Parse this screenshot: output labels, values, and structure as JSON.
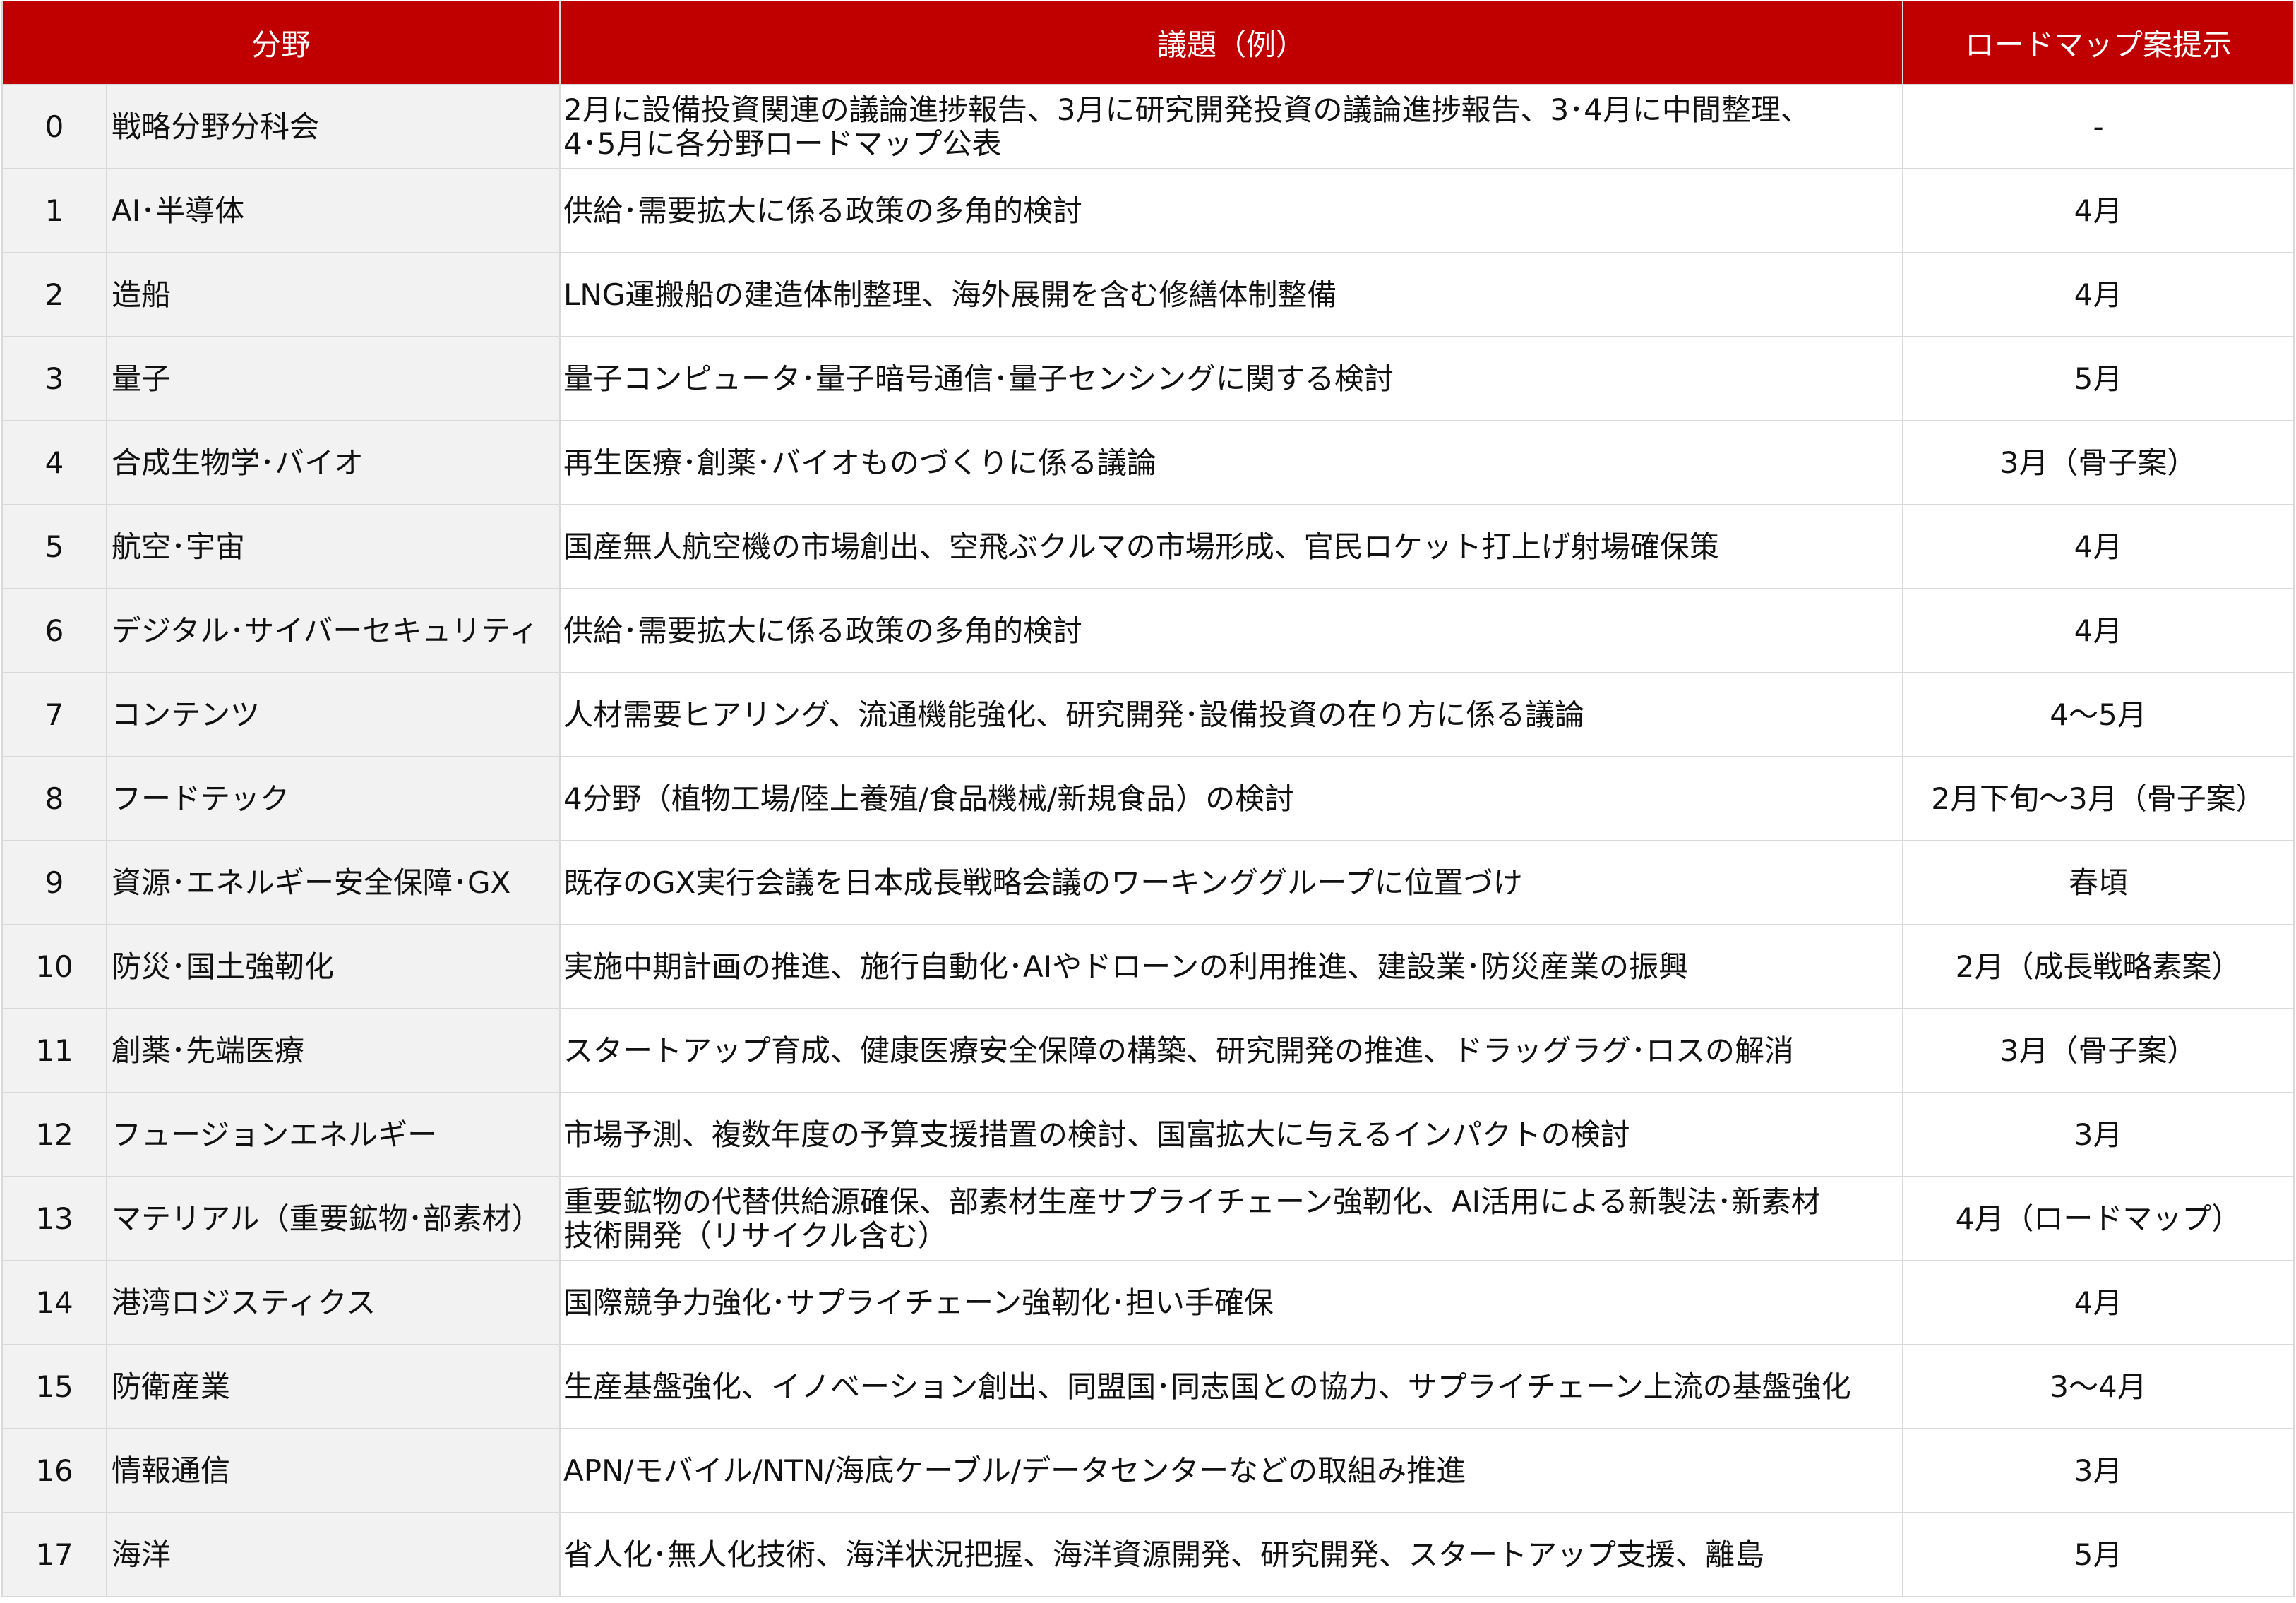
{
  "colors": {
    "header_bg": "#c00000",
    "header_text": "#ffffff",
    "label_col_bg": "#f2f2f2",
    "grid_line": "#d9d9d9"
  },
  "header": {
    "field": "分野",
    "topic": "議題（例）",
    "roadmap": "ロードマップ案提示"
  },
  "rows": [
    {
      "num": "0",
      "field": "戦略分野分科会",
      "topic_lines": [
        "2月に設備投資関連の議論進捗報告、3月に研究開発投資の議論進捗報告、3･4月に中間整理、",
        "4･5月に各分野ロードマップ公表"
      ],
      "roadmap": "-"
    },
    {
      "num": "1",
      "field": "AI･半導体",
      "topic_lines": [
        "供給･需要拡大に係る政策の多角的検討"
      ],
      "roadmap": "4月"
    },
    {
      "num": "2",
      "field": "造船",
      "topic_lines": [
        "LNG運搬船の建造体制整理、海外展開を含む修繕体制整備"
      ],
      "roadmap": "4月"
    },
    {
      "num": "3",
      "field": "量子",
      "topic_lines": [
        "量子コンピュータ･量子暗号通信･量子センシングに関する検討"
      ],
      "roadmap": "5月"
    },
    {
      "num": "4",
      "field": "合成生物学･バイオ",
      "topic_lines": [
        "再生医療･創薬･バイオものづくりに係る議論"
      ],
      "roadmap": "3月（骨子案）"
    },
    {
      "num": "5",
      "field": "航空･宇宙",
      "topic_lines": [
        "国産無人航空機の市場創出、空飛ぶクルマの市場形成、官民ロケット打上げ射場確保策"
      ],
      "roadmap": "4月"
    },
    {
      "num": "6",
      "field": "デジタル･サイバーセキュリティ",
      "topic_lines": [
        "供給･需要拡大に係る政策の多角的検討"
      ],
      "roadmap": "4月"
    },
    {
      "num": "7",
      "field": "コンテンツ",
      "topic_lines": [
        "人材需要ヒアリング、流通機能強化、研究開発･設備投資の在り方に係る議論"
      ],
      "roadmap": "4～5月"
    },
    {
      "num": "8",
      "field": "フードテック",
      "topic_lines": [
        "4分野（植物工場/陸上養殖/食品機械/新規食品）の検討"
      ],
      "roadmap": "2月下旬～3月（骨子案）"
    },
    {
      "num": "9",
      "field": "資源･エネルギー安全保障･GX",
      "topic_lines": [
        "既存のGX実行会議を日本成長戦略会議のワーキンググループに位置づけ"
      ],
      "roadmap": "春頃"
    },
    {
      "num": "10",
      "field": "防災･国土強靭化",
      "topic_lines": [
        "実施中期計画の推進、施行自動化･AIやドローンの利用推進、建設業･防災産業の振興"
      ],
      "roadmap": "2月（成長戦略素案）"
    },
    {
      "num": "11",
      "field": "創薬･先端医療",
      "topic_lines": [
        "スタートアップ育成、健康医療安全保障の構築、研究開発の推進、ドラッグラグ･ロスの解消"
      ],
      "roadmap": "3月（骨子案）"
    },
    {
      "num": "12",
      "field": "フュージョンエネルギー",
      "topic_lines": [
        "市場予測、複数年度の予算支援措置の検討、国富拡大に与えるインパクトの検討"
      ],
      "roadmap": "3月"
    },
    {
      "num": "13",
      "field": "マテリアル（重要鉱物･部素材）",
      "topic_lines": [
        "重要鉱物の代替供給源確保、部素材生産サプライチェーン強靭化、AI活用による新製法･新素材",
        "技術開発（リサイクル含む）"
      ],
      "roadmap": "4月（ロードマップ）"
    },
    {
      "num": "14",
      "field": "港湾ロジスティクス",
      "topic_lines": [
        "国際競争力強化･サプライチェーン強靭化･担い手確保"
      ],
      "roadmap": "4月"
    },
    {
      "num": "15",
      "field": "防衛産業",
      "topic_lines": [
        "生産基盤強化、イノベーション創出、同盟国･同志国との協力、サプライチェーン上流の基盤強化"
      ],
      "roadmap": "3～4月"
    },
    {
      "num": "16",
      "field": "情報通信",
      "topic_lines": [
        "APN/モバイル/NTN/海底ケーブル/データセンターなどの取組み推進"
      ],
      "roadmap": "3月"
    },
    {
      "num": "17",
      "field": "海洋",
      "topic_lines": [
        "省人化･無人化技術、海洋状況把握、海洋資源開発、研究開発、スタートアップ支援、離島"
      ],
      "roadmap": "5月"
    }
  ]
}
